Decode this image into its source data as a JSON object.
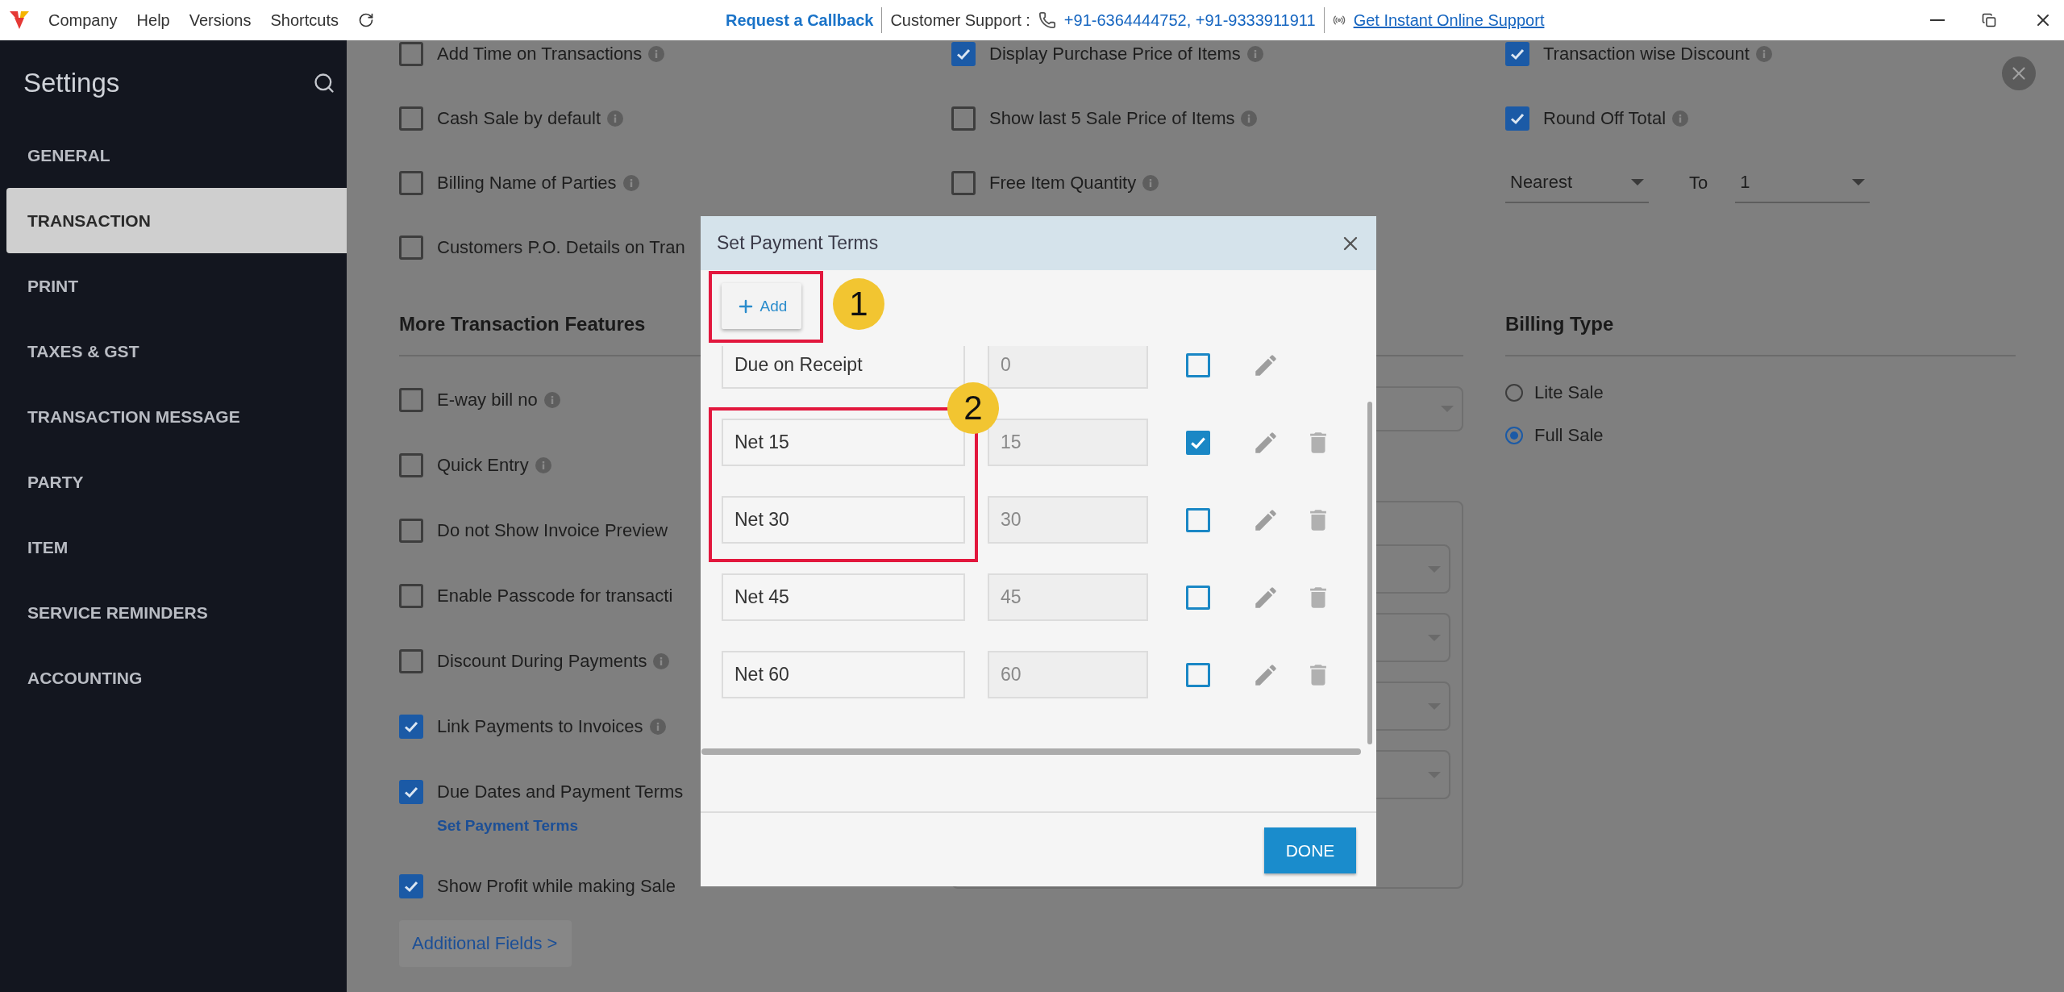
{
  "top_bar": {
    "menu": [
      "Company",
      "Help",
      "Versions",
      "Shortcuts"
    ],
    "callback_link": "Request a Callback",
    "support_label": "Customer Support :",
    "support_phones": "+91-6364444752, +91-9333911911",
    "online_support_link": "Get Instant Online Support"
  },
  "sidebar": {
    "title": "Settings",
    "items": [
      {
        "label": "GENERAL",
        "selected": false
      },
      {
        "label": "TRANSACTION",
        "selected": true
      },
      {
        "label": "PRINT",
        "selected": false
      },
      {
        "label": "TAXES & GST",
        "selected": false
      },
      {
        "label": "TRANSACTION MESSAGE",
        "selected": false
      },
      {
        "label": "PARTY",
        "selected": false
      },
      {
        "label": "ITEM",
        "selected": false
      },
      {
        "label": "SERVICE REMINDERS",
        "selected": false
      },
      {
        "label": "ACCOUNTING",
        "selected": false
      }
    ]
  },
  "settings": {
    "column_1": [
      {
        "label": "Add Time on Transactions",
        "checked": false,
        "info": true
      },
      {
        "label": "Cash Sale by default",
        "checked": false,
        "info": true
      },
      {
        "label": "Billing Name of Parties",
        "checked": false,
        "info": true
      },
      {
        "label": "Customers P.O. Details on Tran",
        "checked": false,
        "info": false
      }
    ],
    "column_2": [
      {
        "label": "Display Purchase Price of Items",
        "checked": true,
        "info": true
      },
      {
        "label": "Show last 5 Sale Price of Items",
        "checked": false,
        "info": true
      },
      {
        "label": "Free Item Quantity",
        "checked": false,
        "info": true
      }
    ],
    "column_3": [
      {
        "label": "Transaction wise Discount",
        "checked": true,
        "info": true
      },
      {
        "label": "Round Off Total",
        "checked": true,
        "info": true
      }
    ],
    "rounding": {
      "mode": "Nearest",
      "to_label": "To",
      "to": "1"
    }
  },
  "more_features": {
    "title": "More Transaction Features",
    "options": [
      {
        "label": "E-way bill no",
        "checked": false,
        "info": true
      },
      {
        "label": "Quick Entry",
        "checked": false,
        "info": true
      },
      {
        "label": "Do not Show Invoice Preview",
        "checked": false,
        "info": false
      },
      {
        "label": "Enable Passcode for transacti",
        "checked": false,
        "info": false
      },
      {
        "label": "Discount During Payments",
        "checked": false,
        "info": true
      },
      {
        "label": "Link Payments to Invoices",
        "checked": true,
        "info": true
      },
      {
        "label": "Due Dates and Payment Terms",
        "checked": true,
        "info": false,
        "link": "Set Payment Terms"
      },
      {
        "label": "Show Profit while making Sale",
        "checked": true,
        "info": false
      }
    ],
    "additional_fields_button": "Additional Fields >"
  },
  "billing_type": {
    "title": "Billing Type",
    "options": [
      {
        "label": "Lite Sale",
        "selected": false
      },
      {
        "label": "Full Sale",
        "selected": true
      }
    ]
  },
  "dialog": {
    "title": "Set Payment Terms",
    "add_button": "Add",
    "terms": [
      {
        "name": "Due on Receipt",
        "days": "0",
        "checked": false,
        "deletable": false
      },
      {
        "name": "Net 15",
        "days": "15",
        "checked": true,
        "deletable": true
      },
      {
        "name": "Net 30",
        "days": "30",
        "checked": false,
        "deletable": true
      },
      {
        "name": "Net 45",
        "days": "45",
        "checked": false,
        "deletable": true
      },
      {
        "name": "Net 60",
        "days": "60",
        "checked": false,
        "deletable": true
      }
    ],
    "done_button": "DONE"
  },
  "annotations": [
    {
      "label": "1"
    },
    {
      "label": "2"
    }
  ]
}
